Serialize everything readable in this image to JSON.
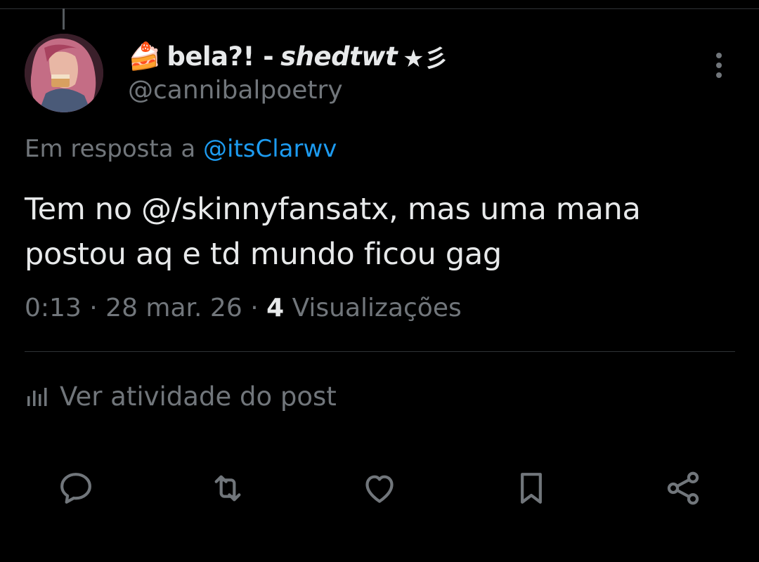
{
  "author": {
    "emoji": "🍰",
    "display_name": "bela?! -",
    "display_name_italic": "shedtwt",
    "name_suffix": "★彡",
    "handle": "@cannibalpoetry"
  },
  "reply": {
    "prefix": "Em resposta a ",
    "mention": "@itsClarwv"
  },
  "tweet": {
    "line1": "Tem no @/skinnyfansatx, mas uma mana",
    "line2": "postou aq e td mundo ficou gag"
  },
  "meta": {
    "time_date": "0:13 · 28 mar. 26 · ",
    "views_count": "4",
    "views_label": " Visualizações"
  },
  "activity": {
    "label": "Ver atividade do post"
  },
  "actions": {
    "icons": [
      "reply-icon",
      "retweet-icon",
      "like-icon",
      "bookmark-icon",
      "share-icon"
    ]
  },
  "colors": {
    "background": "#000000",
    "text_primary": "#e7e9ea",
    "text_secondary": "#71767b",
    "link": "#1d9bf0",
    "divider": "#2f3336"
  }
}
